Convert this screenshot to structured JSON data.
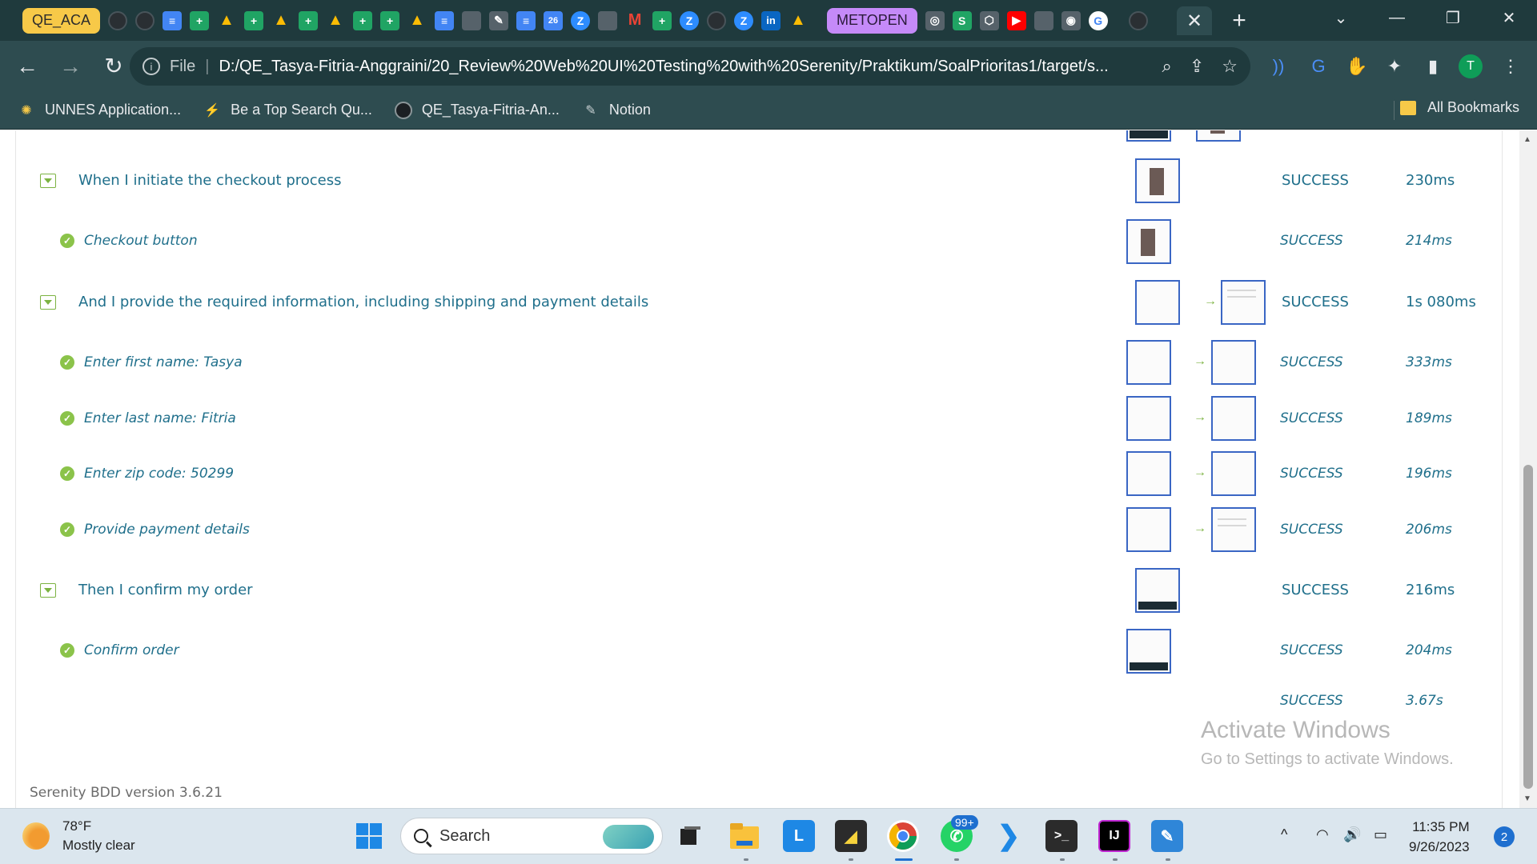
{
  "tabs": {
    "group_qe": "QE_ACA",
    "group_metopen": "METOPEN",
    "close_glyph": "✕",
    "new_tab_glyph": "+"
  },
  "address_bar": {
    "scheme_label": "File",
    "url": "D:/QE_Tasya-Fitria-Anggraini/20_Review%20Web%20UI%20Testing%20with%20Serenity/Praktikum/SoalPrioritas1/target/s..."
  },
  "bookmarks": [
    {
      "label": "UNNES Application...",
      "icon": "unnes-logo-icon"
    },
    {
      "label": "Be a Top Search Qu...",
      "icon": "bookmark-site-icon"
    },
    {
      "label": "QE_Tasya-Fitria-An...",
      "icon": "github-icon"
    },
    {
      "label": "Notion",
      "icon": "notion-icon"
    }
  ],
  "bookmarks_all": "All Bookmarks",
  "report": {
    "steps": [
      {
        "kind": "step",
        "label": "When I initiate the checkout process",
        "result": "SUCCESS",
        "duration": "230ms",
        "thumbs": 1
      },
      {
        "kind": "sub",
        "label": "Checkout button",
        "result": "SUCCESS",
        "duration": "214ms",
        "thumbs": 1
      },
      {
        "kind": "step",
        "label": "And I provide the required information, including shipping and payment details",
        "result": "SUCCESS",
        "duration": "1s 080ms",
        "thumbs": 2
      },
      {
        "kind": "sub",
        "label": "Enter first name: Tasya",
        "result": "SUCCESS",
        "duration": "333ms",
        "thumbs": 2
      },
      {
        "kind": "sub",
        "label": "Enter last name: Fitria",
        "result": "SUCCESS",
        "duration": "189ms",
        "thumbs": 2
      },
      {
        "kind": "sub",
        "label": "Enter zip code: 50299",
        "result": "SUCCESS",
        "duration": "196ms",
        "thumbs": 2
      },
      {
        "kind": "sub",
        "label": "Provide payment details",
        "result": "SUCCESS",
        "duration": "206ms",
        "thumbs": 2
      },
      {
        "kind": "step",
        "label": "Then I confirm my order",
        "result": "SUCCESS",
        "duration": "216ms",
        "thumbs": 1
      },
      {
        "kind": "sub",
        "label": "Confirm order",
        "result": "SUCCESS",
        "duration": "204ms",
        "thumbs": 1
      }
    ],
    "overall_result": "SUCCESS",
    "overall_duration": "3.67s"
  },
  "watermark": {
    "title": "Activate Windows",
    "subtitle": "Go to Settings to activate Windows."
  },
  "footer": "Serenity BDD version 3.6.21",
  "taskbar": {
    "weather_temp": "78°F",
    "weather_desc": "Mostly clear",
    "search_placeholder": "Search",
    "whatsapp_badge": "99+",
    "time": "11:35 PM",
    "date": "9/26/2023",
    "notifications": "2"
  },
  "colors": {
    "browser_frame": "#2e4c50",
    "report_text": "#1f6f8b",
    "success_green": "#8bc34a"
  }
}
